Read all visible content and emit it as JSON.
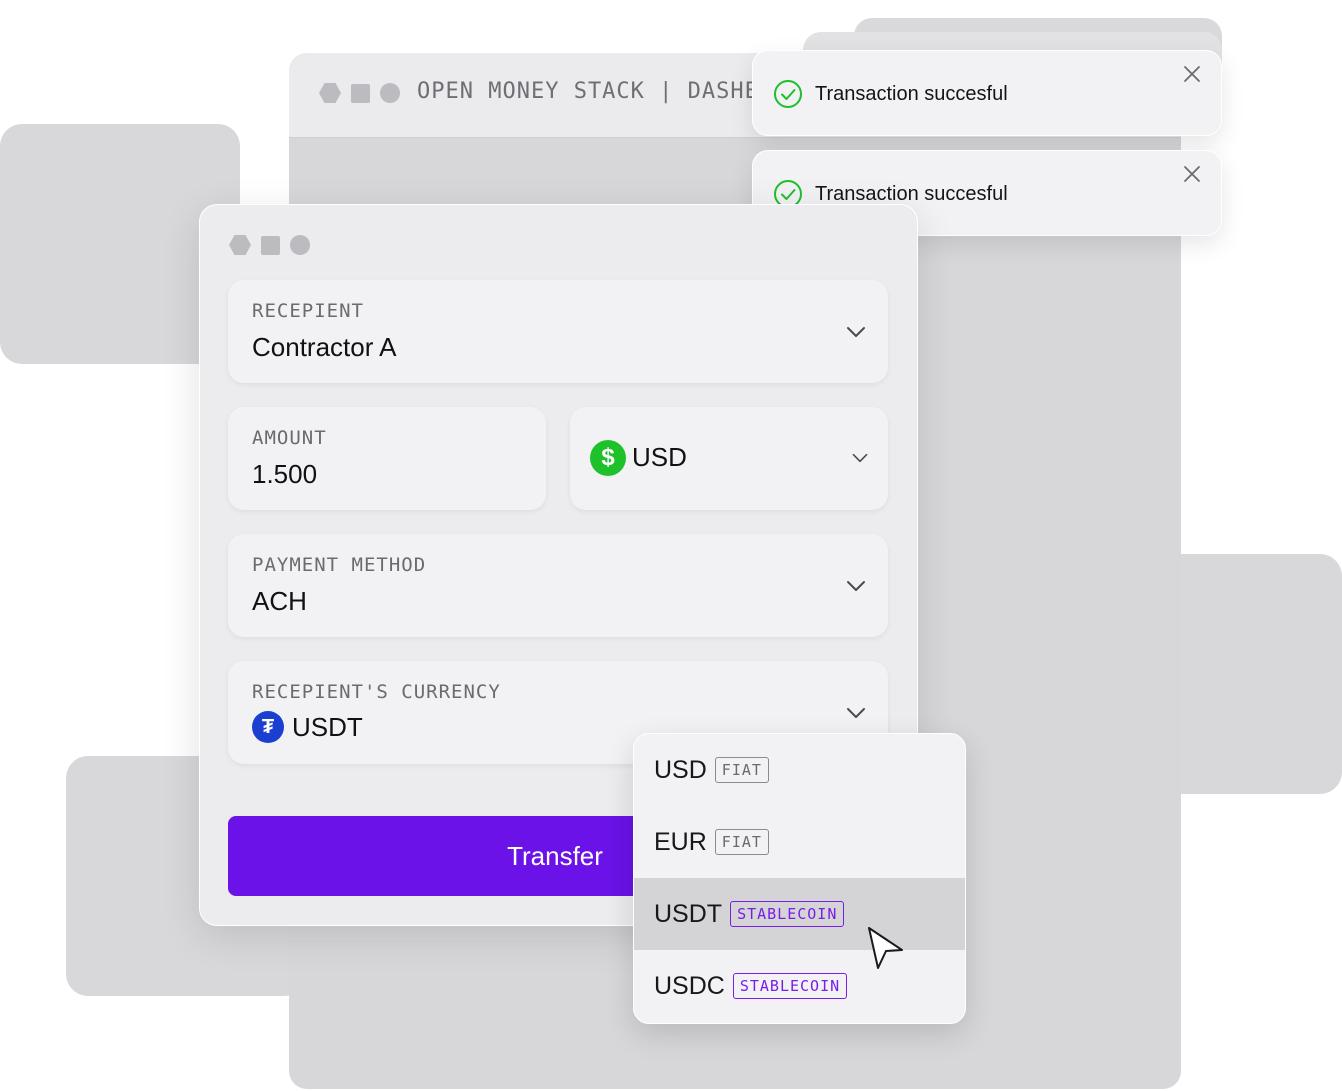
{
  "background_window": {
    "title": "OPEN MONEY STACK  |  DASHE"
  },
  "toasts": [
    {
      "message": "Transaction succesful",
      "status_color": "#1fbf2b"
    },
    {
      "message": "Transaction succesful",
      "status_color": "#1fbf2b"
    }
  ],
  "form": {
    "recipient": {
      "label": "RECEPIENT",
      "value": "Contractor A"
    },
    "amount": {
      "label": "AMOUNT",
      "value": "1.500"
    },
    "currency": {
      "value": "USD",
      "icon": "dollar-icon"
    },
    "payment_method": {
      "label": "PAYMENT METHOD",
      "value": "ACH"
    },
    "recipient_currency": {
      "label": "RECEPIENT'S CURRENCY",
      "value": "USDT",
      "icon": "tether-icon"
    },
    "transfer_label": "Transfer"
  },
  "dropdown": {
    "options": [
      {
        "currency": "USD",
        "tag": "FIAT"
      },
      {
        "currency": "EUR",
        "tag": "FIAT"
      },
      {
        "currency": "USDT",
        "tag": "STABLECOIN",
        "selected": true
      },
      {
        "currency": "USDC",
        "tag": "STABLECOIN"
      }
    ]
  },
  "colors": {
    "accent": "#6a12e8",
    "success": "#1fbf2b",
    "usd_icon": "#1fc12b",
    "usdt_icon": "#1b3fd1",
    "stablecoin_tag": "#7a1de8"
  }
}
